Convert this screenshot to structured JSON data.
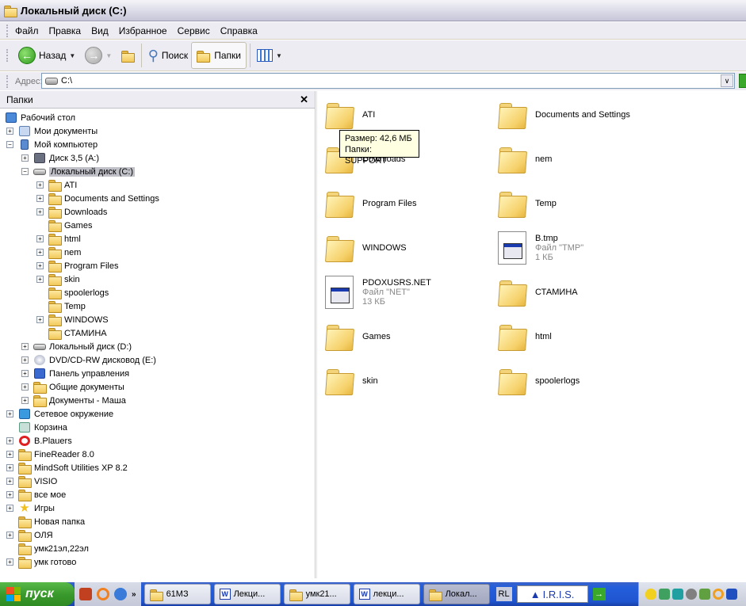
{
  "window": {
    "title": "Локальный диск (C:)"
  },
  "menu": [
    "Файл",
    "Правка",
    "Вид",
    "Избранное",
    "Сервис",
    "Справка"
  ],
  "toolbar": {
    "back_label": "Назад",
    "search_label": "Поиск",
    "folders_label": "Папки"
  },
  "address": {
    "label": "Адрес:",
    "value": "C:\\"
  },
  "folders_pane": {
    "title": "Папки",
    "tree": [
      {
        "label": "Рабочий стол",
        "level": 0,
        "expander": "",
        "icon": "desktop-icon"
      },
      {
        "label": "Мои документы",
        "level": 1,
        "expander": "+",
        "icon": "my-documents-icon"
      },
      {
        "label": "Мой компьютер",
        "level": 1,
        "expander": "-",
        "icon": "my-computer-icon"
      },
      {
        "label": "Диск 3,5 (A:)",
        "level": 2,
        "expander": "+",
        "icon": "floppy-icon"
      },
      {
        "label": "Локальный диск (C:)",
        "level": 2,
        "expander": "-",
        "icon": "drive-icon",
        "selected": true
      },
      {
        "label": "ATI",
        "level": 3,
        "expander": "+",
        "icon": "folder-icon"
      },
      {
        "label": "Documents and Settings",
        "level": 3,
        "expander": "+",
        "icon": "folder-icon"
      },
      {
        "label": "Downloads",
        "level": 3,
        "expander": "+",
        "icon": "folder-icon"
      },
      {
        "label": "Games",
        "level": 3,
        "expander": "",
        "icon": "folder-icon"
      },
      {
        "label": "html",
        "level": 3,
        "expander": "+",
        "icon": "folder-icon"
      },
      {
        "label": "nem",
        "level": 3,
        "expander": "+",
        "icon": "folder-icon"
      },
      {
        "label": "Program Files",
        "level": 3,
        "expander": "+",
        "icon": "folder-icon"
      },
      {
        "label": "skin",
        "level": 3,
        "expander": "+",
        "icon": "folder-icon"
      },
      {
        "label": "spoolerlogs",
        "level": 3,
        "expander": "",
        "icon": "folder-icon"
      },
      {
        "label": "Temp",
        "level": 3,
        "expander": "",
        "icon": "folder-icon"
      },
      {
        "label": "WINDOWS",
        "level": 3,
        "expander": "+",
        "icon": "folder-icon"
      },
      {
        "label": "СТАМИНА",
        "level": 3,
        "expander": "",
        "icon": "folder-icon"
      },
      {
        "label": "Локальный диск (D:)",
        "level": 2,
        "expander": "+",
        "icon": "drive-icon"
      },
      {
        "label": "DVD/CD-RW дисковод (E:)",
        "level": 2,
        "expander": "+",
        "icon": "dvd-drive-icon"
      },
      {
        "label": "Панель управления",
        "level": 2,
        "expander": "+",
        "icon": "control-panel-icon"
      },
      {
        "label": "Общие документы",
        "level": 2,
        "expander": "+",
        "icon": "folder-icon"
      },
      {
        "label": "Документы - Маша",
        "level": 2,
        "expander": "+",
        "icon": "folder-icon"
      },
      {
        "label": "Сетевое окружение",
        "level": 1,
        "expander": "+",
        "icon": "network-icon"
      },
      {
        "label": "Корзина",
        "level": 1,
        "expander": "",
        "icon": "recycle-bin-icon"
      },
      {
        "label": "B.Plauers",
        "level": 1,
        "expander": "+",
        "icon": "no-entry-icon"
      },
      {
        "label": "FineReader 8.0",
        "level": 1,
        "expander": "+",
        "icon": "folder-icon"
      },
      {
        "label": "MindSoft Utilities XP 8.2",
        "level": 1,
        "expander": "+",
        "icon": "folder-icon"
      },
      {
        "label": "VISIO",
        "level": 1,
        "expander": "+",
        "icon": "folder-icon"
      },
      {
        "label": "все мое",
        "level": 1,
        "expander": "+",
        "icon": "folder-icon"
      },
      {
        "label": "Игры",
        "level": 1,
        "expander": "+",
        "icon": "star-icon"
      },
      {
        "label": "Новая папка",
        "level": 1,
        "expander": "",
        "icon": "folder-icon"
      },
      {
        "label": "ОЛЯ",
        "level": 1,
        "expander": "+",
        "icon": "folder-icon"
      },
      {
        "label": "умк21эл,22эл",
        "level": 1,
        "expander": "",
        "icon": "folder-icon"
      },
      {
        "label": "умк готово",
        "level": 1,
        "expander": "+",
        "icon": "folder-icon"
      }
    ]
  },
  "content": {
    "items": [
      {
        "name": "ATI",
        "type": "folder"
      },
      {
        "name": "Documents and Settings",
        "type": "folder"
      },
      {
        "name": "Downloads",
        "type": "folder"
      },
      {
        "name": "nem",
        "type": "folder"
      },
      {
        "name": "Program Files",
        "type": "folder"
      },
      {
        "name": "Temp",
        "type": "folder"
      },
      {
        "name": "WINDOWS",
        "type": "folder"
      },
      {
        "name": "B.tmp",
        "type": "file",
        "kind": "Файл \"TMP\"",
        "size": "1 КБ"
      },
      {
        "name": "PDOXUSRS.NET",
        "type": "file",
        "kind": "Файл \"NET\"",
        "size": "13 КБ"
      },
      {
        "name": "СТАМИНА",
        "type": "folder"
      },
      {
        "name": "Games",
        "type": "folder"
      },
      {
        "name": "html",
        "type": "folder"
      },
      {
        "name": "skin",
        "type": "folder"
      },
      {
        "name": "spoolerlogs",
        "type": "folder"
      }
    ],
    "tooltip": {
      "line1": "Размер: 42,6 МБ",
      "line2": "Папки: SUPPORT"
    }
  },
  "taskbar": {
    "start_label": "пуск",
    "tasks": [
      {
        "label": "61МЗ",
        "icon": "folder-icon"
      },
      {
        "label": "Лекци...",
        "icon": "word-icon"
      },
      {
        "label": "умк21...",
        "icon": "folder-icon"
      },
      {
        "label": "лекци...",
        "icon": "word-icon"
      },
      {
        "label": "Локал...",
        "icon": "explorer-icon",
        "active": true
      }
    ],
    "lang": "RL",
    "iris_label": "I.R.I.S."
  }
}
